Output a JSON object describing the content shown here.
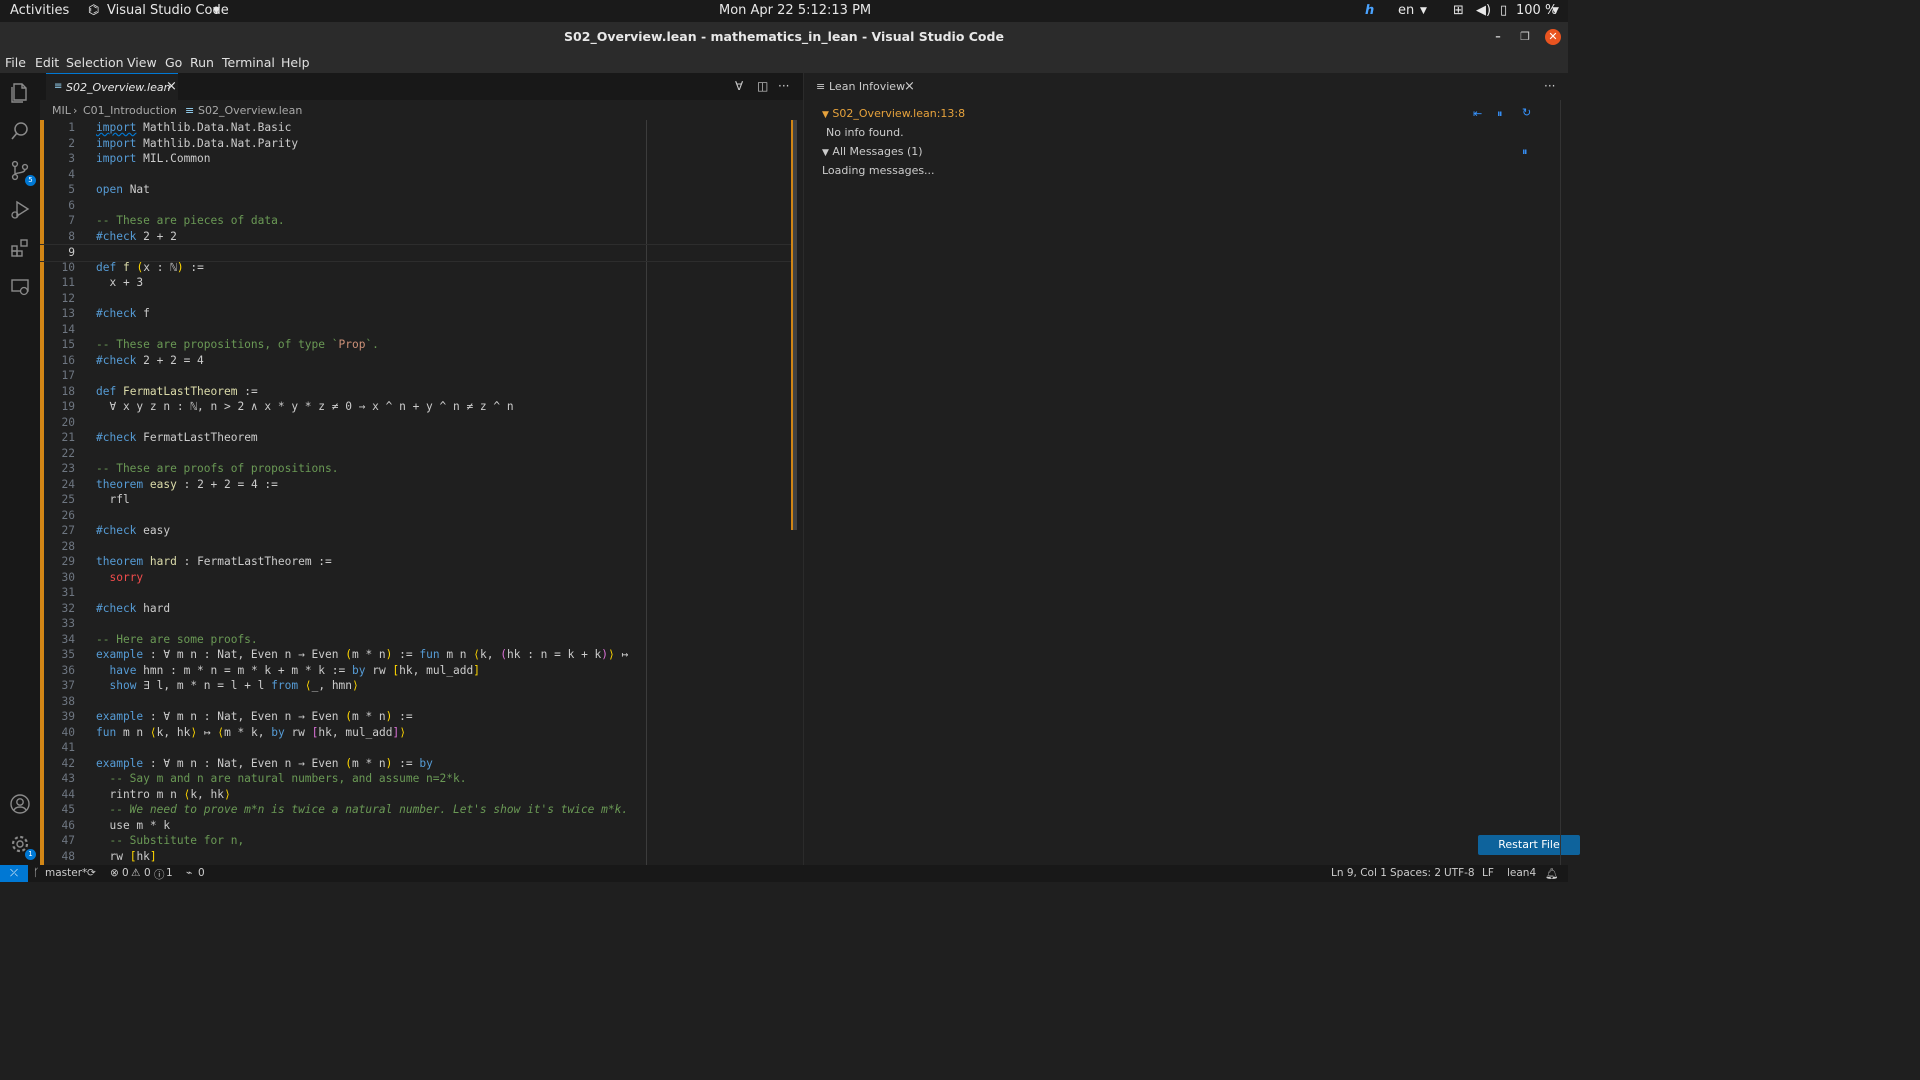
{
  "system_bar": {
    "activities": "Activities",
    "app_name": "Visual Studio Code",
    "clock": "Mon Apr 22  5:12:13 PM",
    "lang": "en",
    "battery": "100 %"
  },
  "window": {
    "title": "S02_Overview.lean - mathematics_in_lean - Visual Studio Code"
  },
  "menu": [
    "File",
    "Edit",
    "Selection",
    "View",
    "Go",
    "Run",
    "Terminal",
    "Help"
  ],
  "activity_bar": {
    "source_control_badge": "5",
    "settings_badge": "1"
  },
  "editor": {
    "tab_label": "S02_Overview.lean",
    "breadcrumb": [
      "MIL",
      "C01_Introduction",
      "S02_Overview.lean"
    ],
    "current_line": 9
  },
  "code_lines": [
    {
      "n": "1",
      "t": "import Mathlib.Data.Nat.Basic"
    },
    {
      "n": "2",
      "t": "import Mathlib.Data.Nat.Parity"
    },
    {
      "n": "3",
      "t": "import MIL.Common"
    },
    {
      "n": "4",
      "t": ""
    },
    {
      "n": "5",
      "t": "open Nat"
    },
    {
      "n": "6",
      "t": ""
    },
    {
      "n": "7",
      "t": "-- These are pieces of data."
    },
    {
      "n": "8",
      "t": "#check 2 + 2"
    },
    {
      "n": "9",
      "t": ""
    },
    {
      "n": "10",
      "t": "def f (x : ℕ) :="
    },
    {
      "n": "11",
      "t": "  x + 3"
    },
    {
      "n": "12",
      "t": ""
    },
    {
      "n": "13",
      "t": "#check f"
    },
    {
      "n": "14",
      "t": ""
    },
    {
      "n": "15",
      "t": "-- These are propositions, of type `Prop`."
    },
    {
      "n": "16",
      "t": "#check 2 + 2 = 4"
    },
    {
      "n": "17",
      "t": ""
    },
    {
      "n": "18",
      "t": "def FermatLastTheorem :="
    },
    {
      "n": "19",
      "t": "  ∀ x y z n : ℕ, n > 2 ∧ x * y * z ≠ 0 → x ^ n + y ^ n ≠ z ^ n"
    },
    {
      "n": "20",
      "t": ""
    },
    {
      "n": "21",
      "t": "#check FermatLastTheorem"
    },
    {
      "n": "22",
      "t": ""
    },
    {
      "n": "23",
      "t": "-- These are proofs of propositions."
    },
    {
      "n": "24",
      "t": "theorem easy : 2 + 2 = 4 :="
    },
    {
      "n": "25",
      "t": "  rfl"
    },
    {
      "n": "26",
      "t": ""
    },
    {
      "n": "27",
      "t": "#check easy"
    },
    {
      "n": "28",
      "t": ""
    },
    {
      "n": "29",
      "t": "theorem hard : FermatLastTheorem :="
    },
    {
      "n": "30",
      "t": "  sorry"
    },
    {
      "n": "31",
      "t": ""
    },
    {
      "n": "32",
      "t": "#check hard"
    },
    {
      "n": "33",
      "t": ""
    },
    {
      "n": "34",
      "t": "-- Here are some proofs."
    },
    {
      "n": "35",
      "t": "example : ∀ m n : Nat, Even n → Even (m * n) := fun m n ⟨k, (hk : n = k + k)⟩ ↦"
    },
    {
      "n": "36",
      "t": "  have hmn : m * n = m * k + m * k := by rw [hk, mul_add]"
    },
    {
      "n": "37",
      "t": "  show ∃ l, m * n = l + l from ⟨_, hmn⟩"
    },
    {
      "n": "38",
      "t": ""
    },
    {
      "n": "39",
      "t": "example : ∀ m n : Nat, Even n → Even (m * n) :="
    },
    {
      "n": "40",
      "t": "fun m n ⟨k, hk⟩ ↦ ⟨m * k, by rw [hk, mul_add]⟩"
    },
    {
      "n": "41",
      "t": ""
    },
    {
      "n": "42",
      "t": "example : ∀ m n : Nat, Even n → Even (m * n) := by"
    },
    {
      "n": "43",
      "t": "  -- Say m and n are natural numbers, and assume n=2*k."
    },
    {
      "n": "44",
      "t": "  rintro m n ⟨k, hk⟩"
    },
    {
      "n": "45",
      "t": "  -- We need to prove m*n is twice a natural number. Let's show it's twice m*k."
    },
    {
      "n": "46",
      "t": "  use m * k"
    },
    {
      "n": "47",
      "t": "  -- Substitute for n,"
    },
    {
      "n": "48",
      "t": "  rw [hk]"
    }
  ],
  "infoview": {
    "tab_label": "Lean Infoview",
    "position_header": "S02_Overview.lean:13:8",
    "no_info": "No info found.",
    "all_messages": "All Messages (1)",
    "loading": "Loading messages...",
    "restart_button": "Restart File"
  },
  "status_bar": {
    "branch": "master*",
    "errors": "0",
    "warnings": "0",
    "infos": "1",
    "ports": "0",
    "position": "Ln 9, Col 1",
    "spaces": "Spaces: 2",
    "encoding": "UTF-8",
    "eol": "LF",
    "language": "lean4"
  },
  "colors": {
    "accent": "#0078d4",
    "modified_gutter": "#d18616",
    "keyword": "#569cd6",
    "comment": "#6a9955",
    "infoview_header": "#e6a23c"
  }
}
